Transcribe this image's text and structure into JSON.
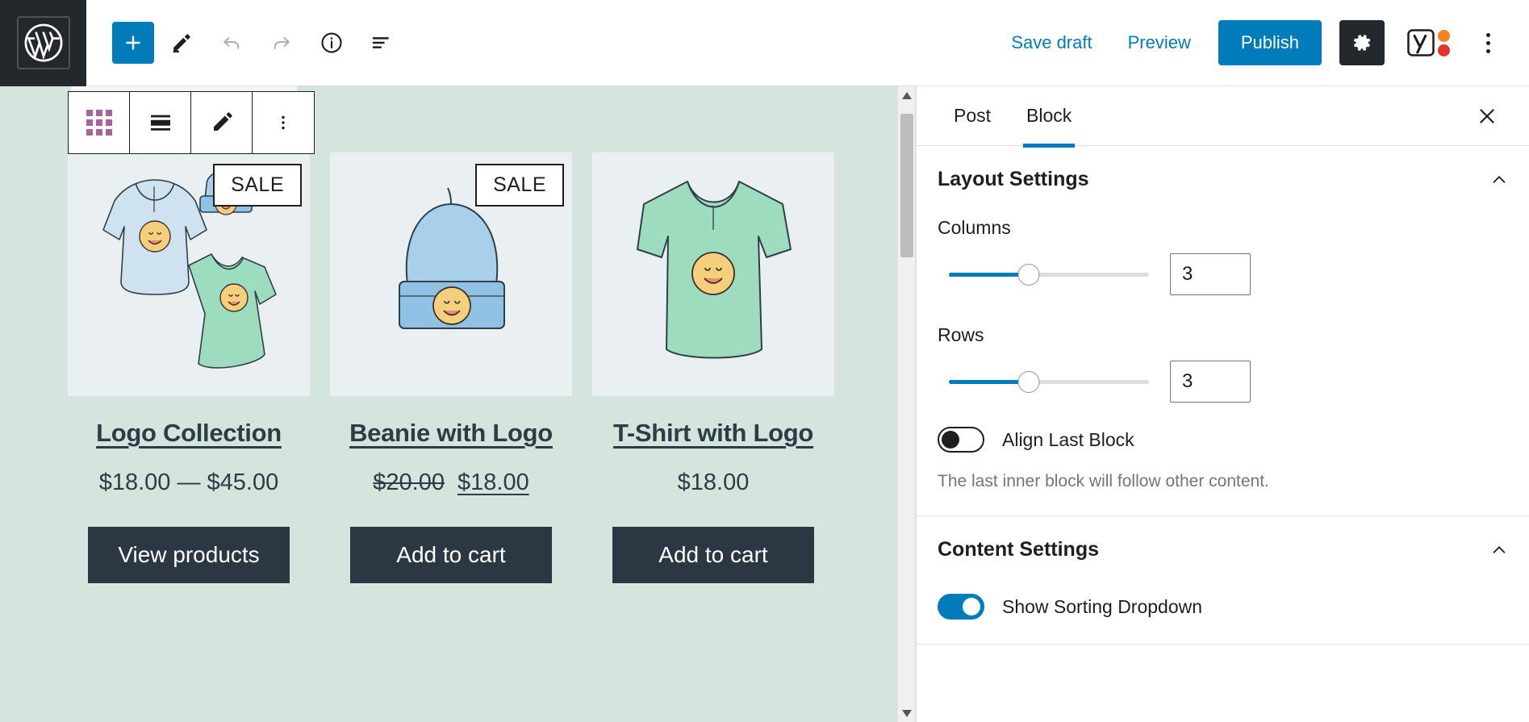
{
  "topbar": {
    "wp_logo_icon": "wordpress-logo-icon",
    "add_block_icon": "plus-icon",
    "tools_icon": "pencil-icon",
    "undo_icon": "undo-arrow-icon",
    "redo_icon": "redo-arrow-icon",
    "info_icon": "info-circle-icon",
    "list_view_icon": "list-view-icon",
    "save_draft_label": "Save draft",
    "preview_label": "Preview",
    "publish_label": "Publish",
    "settings_icon": "gear-icon",
    "yoast_icon": "yoast-seo-icon",
    "options_icon": "kebab-menu-icon",
    "accent_blue": "#007cba",
    "dark": "#23282d",
    "yoast_orange": "#f5821f",
    "yoast_red": "#e5322d"
  },
  "block_toolbar": {
    "grid_icon": "grid-block-icon",
    "align_icon": "align-wide-icon",
    "edit_icon": "pencil-edit-icon",
    "more_icon": "kebab-menu-icon",
    "grid_icon_color": "#a8639a"
  },
  "canvas": {
    "background": "#d5e5dd",
    "products": [
      {
        "name": "Logo Collection",
        "image_alt": "hoodie-beanie-tshirt-collection",
        "sale_badge": "SALE",
        "has_sale": true,
        "price": "$18.00 — $45.00",
        "price_regular": "",
        "price_sale": "",
        "price_is_range": true,
        "button_label": "View products"
      },
      {
        "name": "Beanie with Logo",
        "image_alt": "blue-beanie-with-logo",
        "sale_badge": "SALE",
        "has_sale": true,
        "price": "",
        "price_regular": "$20.00",
        "price_sale": "$18.00",
        "price_is_range": false,
        "button_label": "Add to cart"
      },
      {
        "name": "T-Shirt with Logo",
        "image_alt": "green-tshirt-with-logo",
        "sale_badge": "",
        "has_sale": false,
        "price": "$18.00",
        "price_regular": "",
        "price_sale": "",
        "price_is_range": true,
        "button_label": "Add to cart"
      }
    ],
    "scrollbar": {
      "up_arrow_icon": "triangle-up-icon",
      "down_arrow_icon": "triangle-down-icon"
    }
  },
  "sidebar": {
    "tabs": [
      {
        "label": "Post",
        "active": false
      },
      {
        "label": "Block",
        "active": true
      }
    ],
    "close_icon": "close-x-icon",
    "panels": [
      {
        "title": "Layout Settings",
        "collapse_icon": "chevron-up-icon",
        "columns": {
          "label": "Columns",
          "value": "3",
          "slider_percent": 40
        },
        "rows": {
          "label": "Rows",
          "value": "3",
          "slider_percent": 40
        },
        "align_last_block": {
          "label": "Align Last Block",
          "enabled": false,
          "help": "The last inner block will follow other content."
        }
      },
      {
        "title": "Content Settings",
        "collapse_icon": "chevron-up-icon",
        "show_sorting_dropdown": {
          "label": "Show Sorting Dropdown",
          "enabled": true
        }
      }
    ]
  }
}
